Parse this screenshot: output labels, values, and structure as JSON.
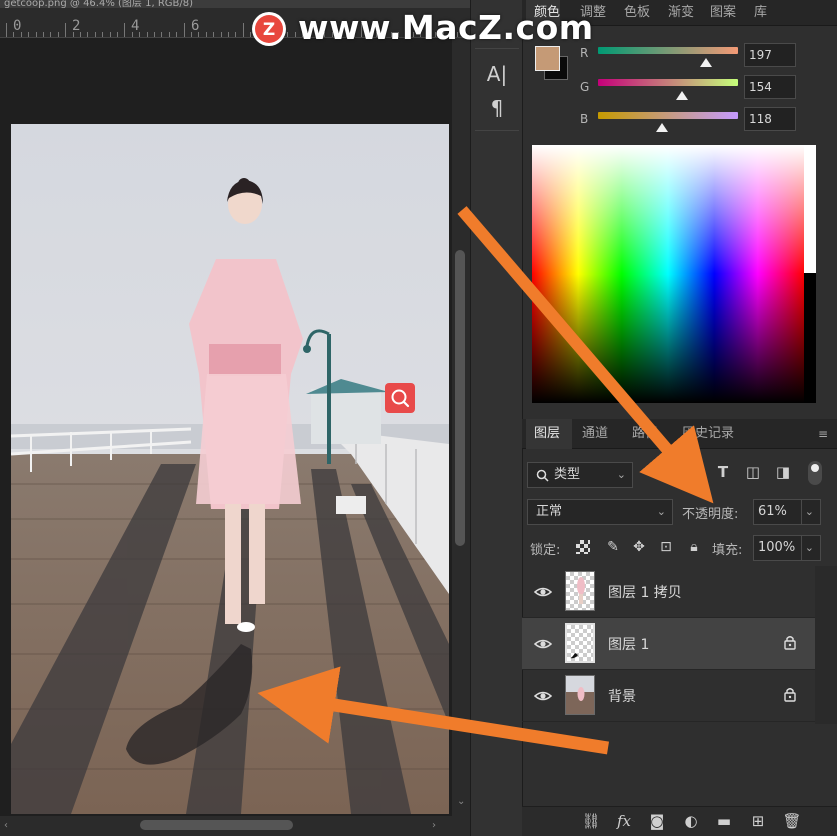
{
  "document": {
    "tab_title": "getcoop.png @ 46.4% (图层 1, RGB/8)",
    "ruler_numbers": [
      "0",
      "2",
      "4",
      "6"
    ]
  },
  "watermark": {
    "text": "www.MacZ.com",
    "logo_letter": "Z"
  },
  "tools": [
    {
      "name": "type-character-icon",
      "glyph": "A|"
    },
    {
      "name": "paragraph-icon",
      "glyph": "¶"
    }
  ],
  "color_panel": {
    "tabs": [
      "颜色",
      "调整",
      "色板",
      "渐变",
      "图案",
      "库"
    ],
    "active_tab": "颜色",
    "foreground_color": "#c59a76",
    "background_color": "#0a0a0a",
    "channels": [
      {
        "label": "R",
        "value": "197",
        "level": 0.77
      },
      {
        "label": "G",
        "value": "154",
        "level": 0.6
      },
      {
        "label": "B",
        "value": "118",
        "level": 0.46
      }
    ]
  },
  "layers_panel": {
    "tabs": [
      "图层",
      "通道",
      "路径",
      "历史记录"
    ],
    "active_tab": "图层",
    "filter_label": "类型",
    "blend_mode": "正常",
    "opacity_label": "不透明度:",
    "opacity_value": "61%",
    "lock_label": "锁定:",
    "fill_label": "填充:",
    "fill_value": "100%",
    "layers": [
      {
        "name": "图层 1 拷贝",
        "visible": true,
        "locked": false,
        "selected": false
      },
      {
        "name": "图层 1",
        "visible": true,
        "locked": true,
        "selected": true
      },
      {
        "name": "背景",
        "visible": true,
        "locked": true,
        "selected": false
      }
    ]
  },
  "colors": {
    "accent_arrow": "#f07c2b",
    "panel_bg": "#2f2f2f",
    "search_badge": "#e84a4a"
  }
}
